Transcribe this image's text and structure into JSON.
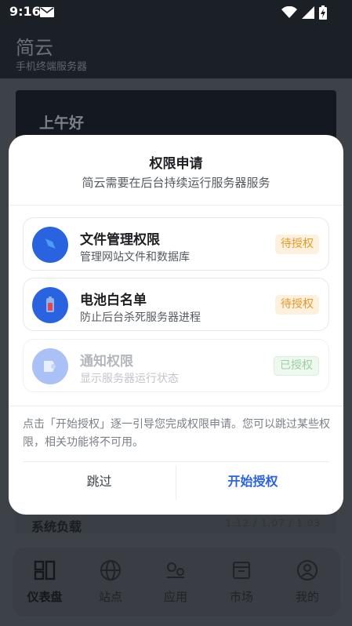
{
  "status_bar": {
    "time": "9:16"
  },
  "header": {
    "title": "简云",
    "subtitle": "手机终端服务器"
  },
  "background": {
    "greeting": "上午好",
    "load_title": "系统负载",
    "load_values": "1.12 / 1.07 / 1.03"
  },
  "dialog": {
    "title": "权限申请",
    "description": "简云需要在后台持续运行服务器服务",
    "permissions": [
      {
        "name": "文件管理权限",
        "desc": "管理网站文件和数据库",
        "status": "待授权",
        "icon": "folder-icon"
      },
      {
        "name": "电池白名单",
        "desc": "防止后台杀死服务器进程",
        "status": "待授权",
        "icon": "battery-icon"
      },
      {
        "name": "通知权限",
        "desc": "显示服务器运行状态",
        "status": "已授权",
        "icon": "notification-icon"
      }
    ],
    "note": "点击「开始授权」逐一引导您完成权限申请。您可以跳过某些权限，相关功能将不可用。",
    "skip_label": "跳过",
    "start_label": "开始授权"
  },
  "nav": [
    {
      "label": "仪表盘",
      "icon": "dashboard-icon"
    },
    {
      "label": "站点",
      "icon": "globe-icon"
    },
    {
      "label": "应用",
      "icon": "apps-icon"
    },
    {
      "label": "市场",
      "icon": "market-icon"
    },
    {
      "label": "我的",
      "icon": "profile-icon"
    }
  ],
  "colors": {
    "accent": "#2a63e0",
    "pending": "#e39a2d",
    "granted": "#9cd0a4"
  }
}
